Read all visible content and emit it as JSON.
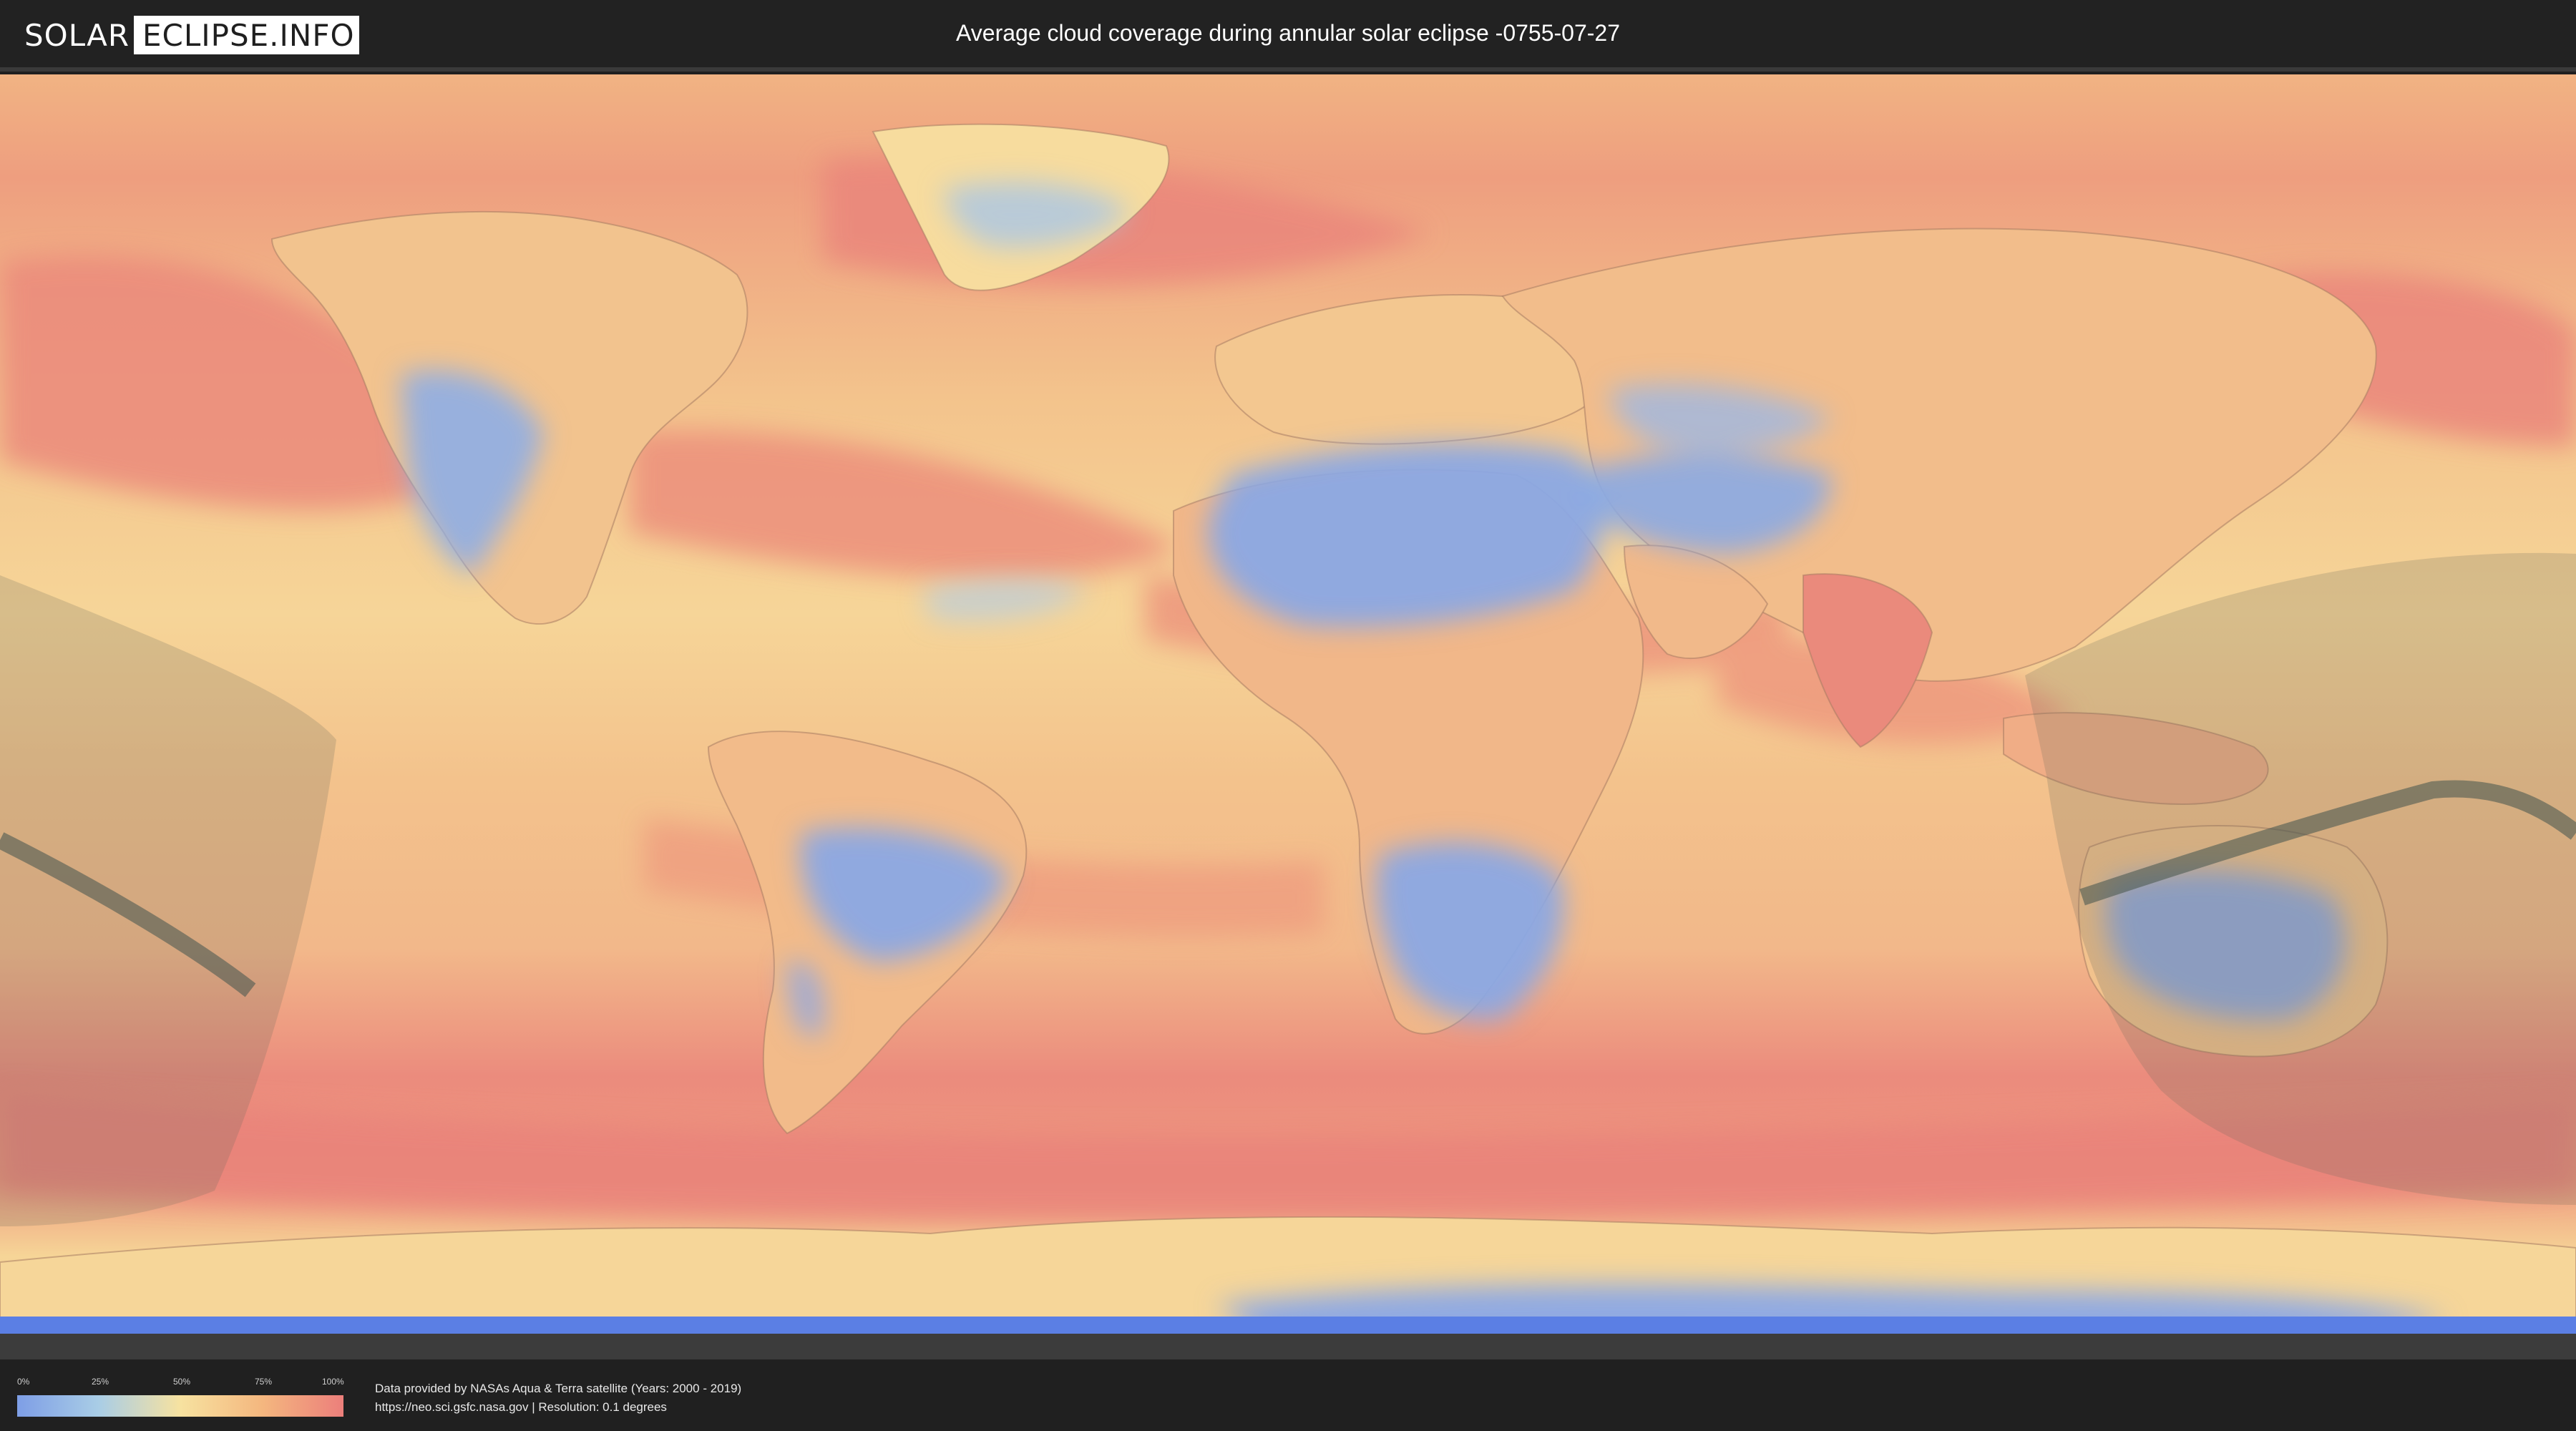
{
  "header": {
    "logo_part1": "SOLAR",
    "logo_part2": "ECLIPSE.INFO",
    "title": "Average cloud coverage during annular solar eclipse -0755-07-27"
  },
  "legend": {
    "ticks": [
      "0%",
      "25%",
      "50%",
      "75%",
      "100%"
    ],
    "colors": [
      "#7e9ee6",
      "#a9cde6",
      "#f7e2a0",
      "#f4b77f",
      "#ec7f7b"
    ]
  },
  "footer": {
    "credit_line1": "Data provided by NASAs Aqua & Terra satellite (Years: 2000 - 2019)",
    "credit_line2": "https://neo.sci.gsfc.nasa.gov | Resolution: 0.1 degrees"
  },
  "map": {
    "colors": {
      "ocean_cloudy": "#eb8a7c",
      "ocean_medium": "#f1b587",
      "clear": "#8eaee6",
      "partial": "#f6d898",
      "polar_blue": "#5b7fe4",
      "shadow": "#6b6b5c",
      "central_path": "#4d5a52"
    }
  }
}
